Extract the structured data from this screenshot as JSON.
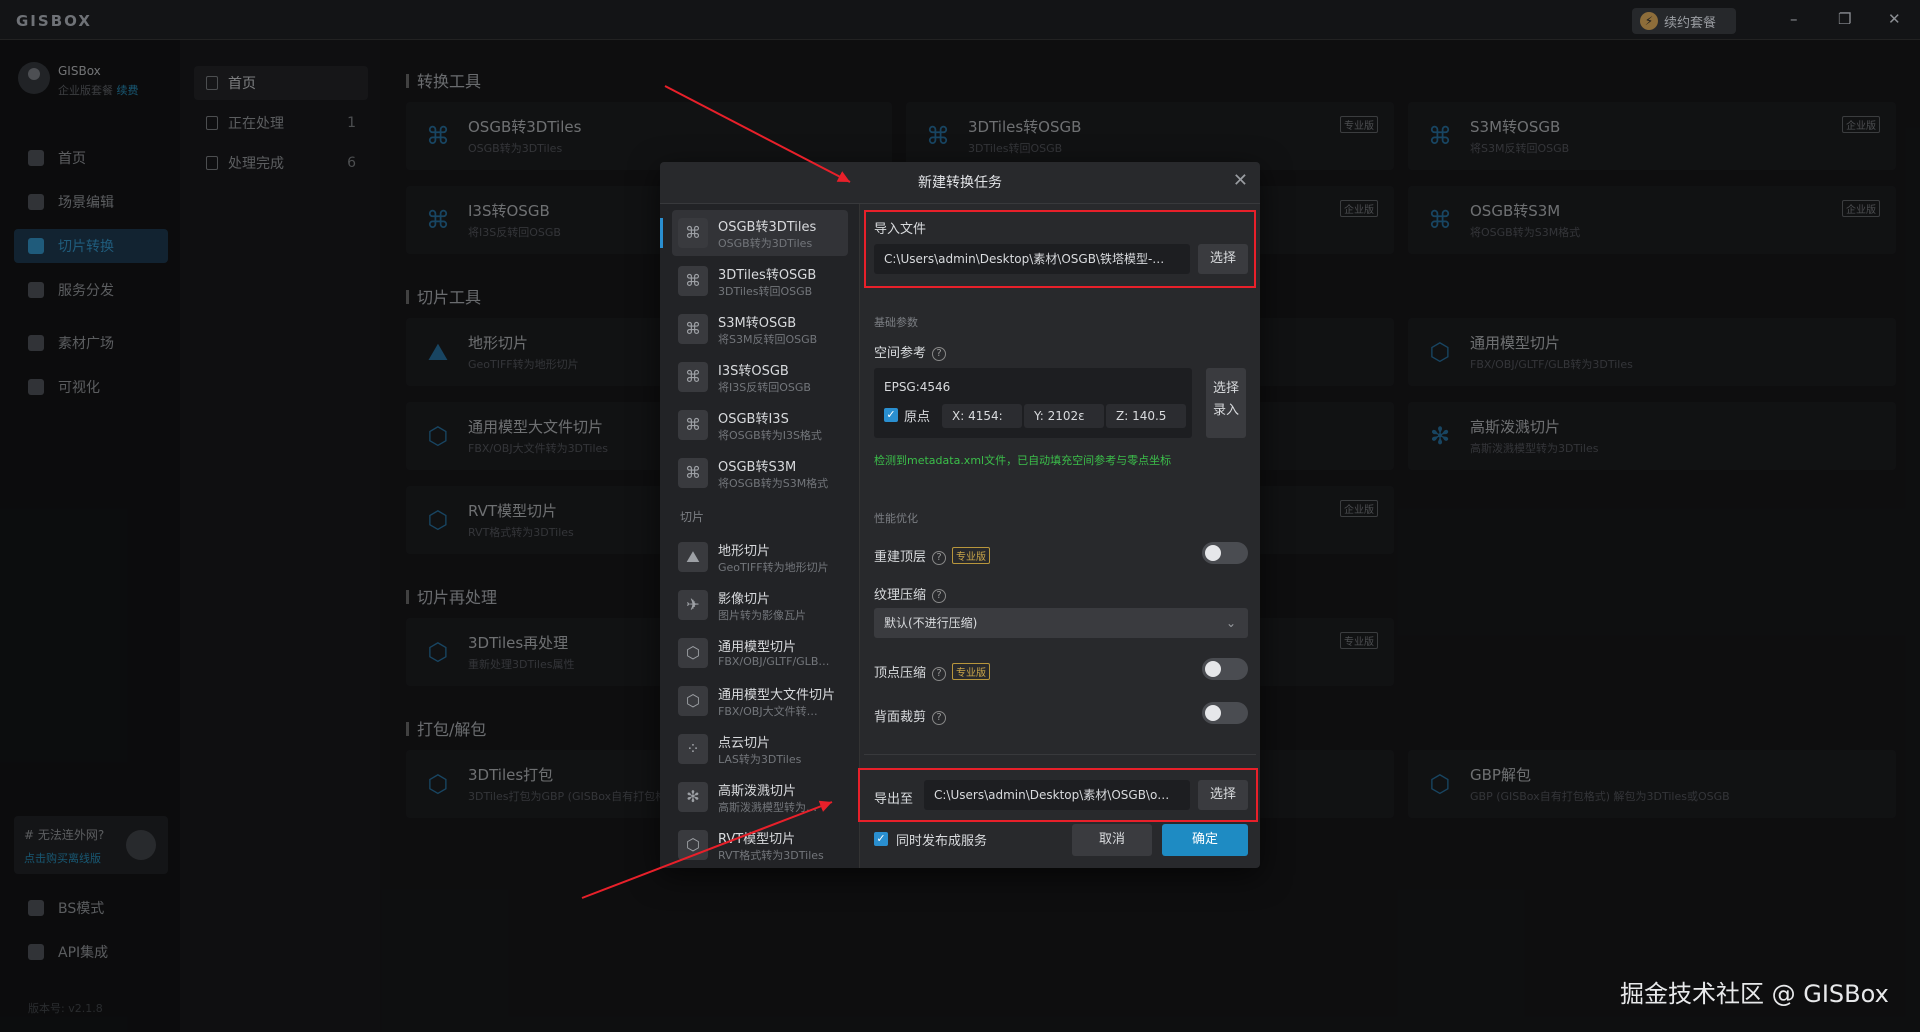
{
  "app": {
    "logo": "GISBOX",
    "renew": "续约套餐",
    "win_min": "–",
    "win_max": "❐",
    "win_close": "✕"
  },
  "user": {
    "name": "GISBox",
    "plan": "企业版套餐",
    "renew_link": "续费"
  },
  "sidebar": {
    "items": [
      {
        "label": "首页"
      },
      {
        "label": "场景编辑"
      },
      {
        "label": "切片转换"
      },
      {
        "label": "服务分发"
      },
      {
        "label": "素材广场"
      },
      {
        "label": "可视化"
      },
      {
        "label": "BS模式"
      },
      {
        "label": "API集成"
      }
    ],
    "promo_title": "# 无法连外网?",
    "promo_link": "点击购买离线版",
    "version": "版本号: v2.1.8"
  },
  "subnav": {
    "items": [
      {
        "label": "首页",
        "count": ""
      },
      {
        "label": "正在处理",
        "count": "1"
      },
      {
        "label": "处理完成",
        "count": "6"
      }
    ]
  },
  "main": {
    "sections": [
      "转换工具",
      "切片工具",
      "切片再处理",
      "打包/解包"
    ],
    "cards": [
      {
        "title": "OSGB转3DTiles",
        "sub": "OSGB转为3DTiles",
        "badge": ""
      },
      {
        "title": "3DTiles转OSGB",
        "sub": "3DTiles转回OSGB",
        "badge": "专业版"
      },
      {
        "title": "S3M转OSGB",
        "sub": "将S3M反转回OSGB",
        "badge": "企业版"
      },
      {
        "title": "I3S转OSGB",
        "sub": "将I3S反转回OSGB",
        "badge": "企业版"
      },
      {
        "title": "OSGB转S3M",
        "sub": "将OSGB转为S3M格式",
        "badge": "企业版"
      },
      {
        "title": "地形切片",
        "sub": "GeoTIFF转为地形切片",
        "badge": ""
      },
      {
        "title": "通用模型切片",
        "sub": "FBX/OBJ/GLTF/GLB转为3DTiles",
        "badge": ""
      },
      {
        "title": "通用模型大文件切片",
        "sub": "FBX/OBJ大文件转为3DTiles",
        "badge": ""
      },
      {
        "title": "高斯泼溅切片",
        "sub": "高斯泼溅模型转为3DTiles",
        "badge": ""
      },
      {
        "title": "RVT模型切片",
        "sub": "RVT格式转为3DTiles",
        "badge": "企业版"
      },
      {
        "title": "3DTiles再处理",
        "sub": "重新处理3DTiles属性",
        "badge": "专业版"
      },
      {
        "title": "3DTiles打包",
        "sub": "3DTiles打包为GBP (GISBox自有打包格式)",
        "badge": ""
      },
      {
        "title": "GBP解包",
        "sub": "GBP (GISBox自有打包格式) 解包为3DTiles或OSGB",
        "badge": ""
      }
    ]
  },
  "dialog": {
    "title": "新建转换任务",
    "close": "✕",
    "category_slice": "切片",
    "items": [
      {
        "title": "OSGB转3DTiles",
        "sub": "OSGB转为3DTiles"
      },
      {
        "title": "3DTiles转OSGB",
        "sub": "3DTiles转回OSGB"
      },
      {
        "title": "S3M转OSGB",
        "sub": "将S3M反转回OSGB"
      },
      {
        "title": "I3S转OSGB",
        "sub": "将I3S反转回OSGB"
      },
      {
        "title": "OSGB转I3S",
        "sub": "将OSGB转为I3S格式"
      },
      {
        "title": "OSGB转S3M",
        "sub": "将OSGB转为S3M格式"
      },
      {
        "title": "地形切片",
        "sub": "GeoTIFF转为地形切片"
      },
      {
        "title": "影像切片",
        "sub": "图片转为影像瓦片"
      },
      {
        "title": "通用模型切片",
        "sub": "FBX/OBJ/GLTF/GLB…"
      },
      {
        "title": "通用模型大文件切片",
        "sub": "FBX/OBJ大文件转…"
      },
      {
        "title": "点云切片",
        "sub": "LAS转为3DTiles"
      },
      {
        "title": "高斯泼溅切片",
        "sub": "高斯泼溅模型转为…"
      },
      {
        "title": "RVT模型切片",
        "sub": "RVT格式转为3DTiles"
      }
    ],
    "import_label": "导入文件",
    "import_path": "C:\\Users\\admin\\Desktop\\素材\\OSGB\\铁塔模型-…",
    "select": "选择",
    "basic_params": "基础参数",
    "spatial_ref": "空间参考",
    "epsg": "EPSG:4546",
    "origin": "原点",
    "x": "X: 4154:",
    "y": "Y: 2102ε",
    "z": "Z: 140.5",
    "select_btn": "选择",
    "input_btn": "录入",
    "detect_msg": "检测到metadata.xml文件，已自动填充空间参考与零点坐标",
    "perf": "性能优化",
    "rebuild_top": "重建顶层",
    "pro_badge": "专业版",
    "texture_compress": "纹理压缩",
    "texture_value": "默认(不进行压缩)",
    "vertex_compress": "顶点压缩",
    "backface_cull": "背面裁剪",
    "export_label": "导出至",
    "export_path": "C:\\Users\\admin\\Desktop\\素材\\OSGB\\o…",
    "publish": "同时发布成服务",
    "cancel": "取消",
    "ok": "确定",
    "accent": "#1e8bc3"
  },
  "watermark": "掘金技术社区 @ GISBox"
}
